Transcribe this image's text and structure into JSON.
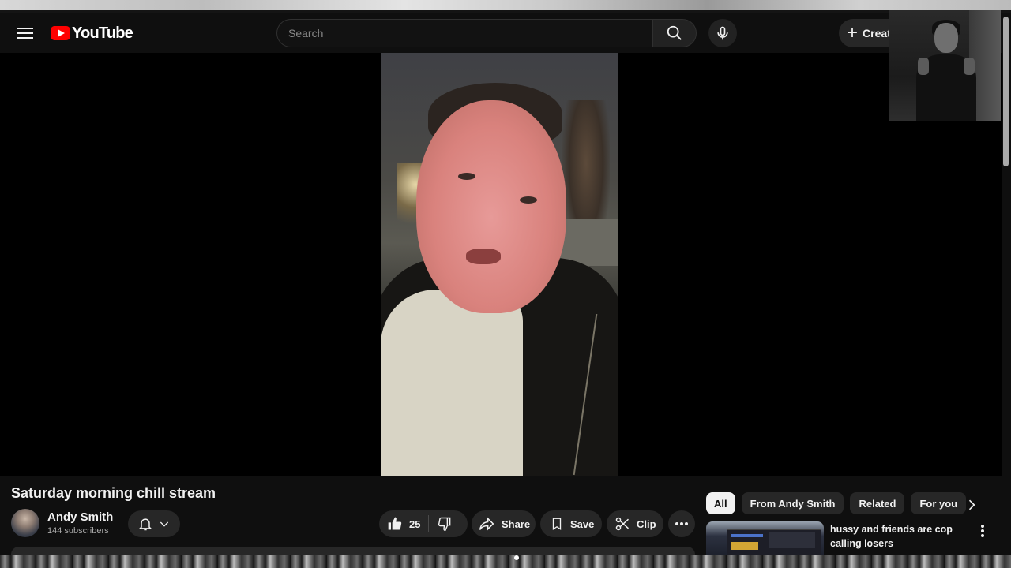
{
  "masthead": {
    "logo_text": "YouTube",
    "search_placeholder": "Search",
    "create_label": "Creat"
  },
  "video": {
    "title": "Saturday morning chill stream"
  },
  "channel": {
    "name": "Andy Smith",
    "subscribers": "144 subscribers"
  },
  "actions": {
    "like_count": "25",
    "share_label": "Share",
    "save_label": "Save",
    "clip_label": "Clip"
  },
  "chips": [
    {
      "label": "All",
      "active": true
    },
    {
      "label": "From Andy Smith",
      "active": false
    },
    {
      "label": "Related",
      "active": false
    },
    {
      "label": "For you",
      "active": false
    }
  ],
  "recommendation": {
    "title": "hussy and friends are cop calling losers"
  },
  "colors": {
    "background": "#0f0f0f",
    "surface": "#272727",
    "brand_red": "#ff0000",
    "text_primary": "#f1f1f1",
    "text_secondary": "#aaaaaa"
  },
  "icons": [
    "menu-icon",
    "youtube-logo-icon",
    "search-icon",
    "mic-icon",
    "plus-icon",
    "bell-icon",
    "chevron-down-icon",
    "thumbs-up-icon",
    "thumbs-down-icon",
    "share-icon",
    "bookmark-icon",
    "scissors-icon",
    "more-horizontal-icon",
    "chevron-right-icon",
    "more-vertical-icon"
  ]
}
